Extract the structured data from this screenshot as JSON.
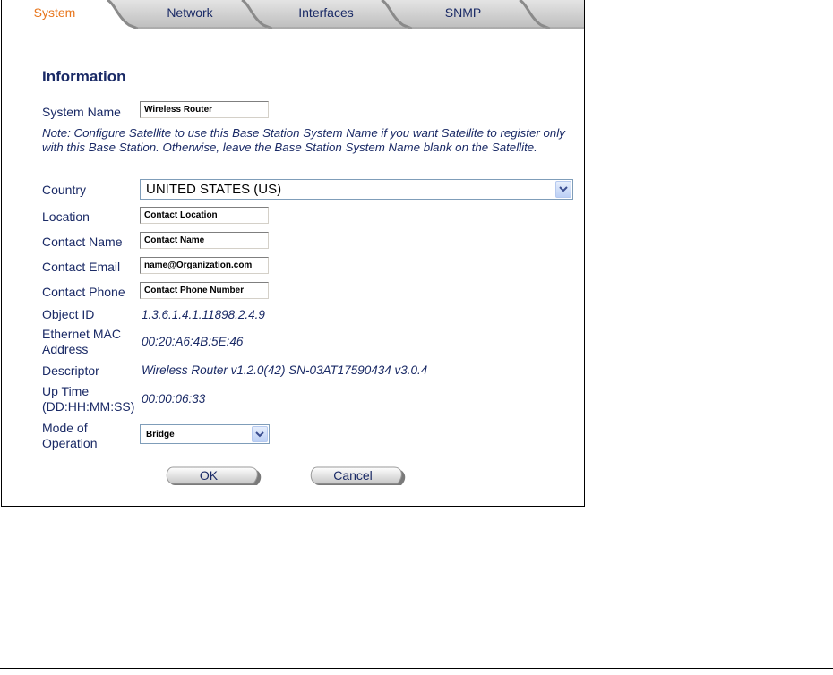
{
  "tabs": [
    {
      "label": "System",
      "active": true
    },
    {
      "label": "Network",
      "active": false
    },
    {
      "label": "Interfaces",
      "active": false
    },
    {
      "label": "SNMP",
      "active": false
    }
  ],
  "section_title": "Information",
  "system_name": {
    "label": "System Name",
    "value": "Wireless Router"
  },
  "note": "Note: Configure Satellite to use this Base Station System Name if you want Satellite to register only with this Base Station. Otherwise, leave the Base Station System Name blank on the Satellite.",
  "country": {
    "label": "Country",
    "value": "UNITED STATES (US)"
  },
  "location": {
    "label": "Location",
    "value": "Contact Location"
  },
  "contact_name": {
    "label": "Contact Name",
    "value": "Contact Name"
  },
  "contact_email": {
    "label": "Contact Email",
    "value": "name@Organization.com"
  },
  "contact_phone": {
    "label": "Contact Phone",
    "value": "Contact Phone Number"
  },
  "object_id": {
    "label": "Object ID",
    "value": "1.3.6.1.4.1.11898.2.4.9"
  },
  "mac": {
    "label_line1": "Ethernet MAC",
    "label_line2": "Address",
    "value": "00:20:A6:4B:5E:46"
  },
  "descriptor": {
    "label": "Descriptor",
    "value": "Wireless Router v1.2.0(42) SN-03AT17590434 v3.0.4"
  },
  "uptime": {
    "label_line1": "Up Time",
    "label_line2": "(DD:HH:MM:SS)",
    "value": "00:00:06:33"
  },
  "mode": {
    "label_line1": "Mode of",
    "label_line2": "Operation",
    "value": "Bridge"
  },
  "buttons": {
    "ok": "OK",
    "cancel": "Cancel"
  },
  "colors": {
    "label_text": "#1a2a66",
    "active_tab": "#e8761c",
    "tab_bar": "#d0d0d0"
  },
  "icons": {
    "dropdown": "chevron-down-icon"
  }
}
